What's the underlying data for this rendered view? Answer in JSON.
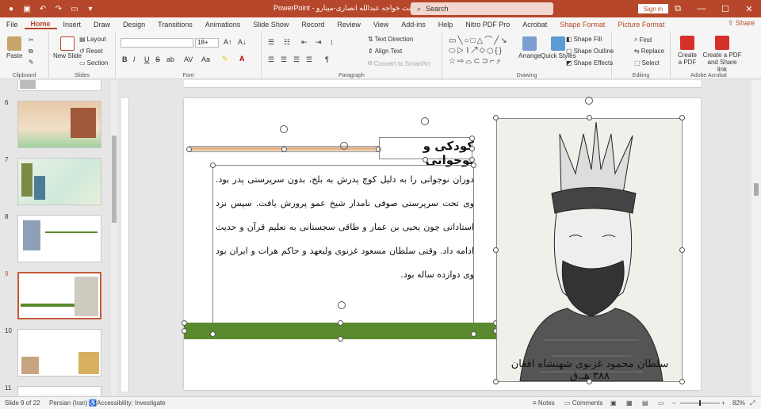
{
  "titlebar": {
    "doc_title": "پاورپوینت خواجه عبدالله انصاری-مینارو  -  PowerPoint",
    "search_placeholder": "Search",
    "signin_label": "Sign in",
    "autosave_label": "Off"
  },
  "menu": {
    "tabs": [
      "File",
      "Home",
      "Insert",
      "Draw",
      "Design",
      "Transitions",
      "Animations",
      "Slide Show",
      "Record",
      "Review",
      "View",
      "Add-ins",
      "Help",
      "Nitro PDF Pro",
      "Acrobat",
      "Shape Format",
      "Picture Format"
    ],
    "active": "Home",
    "share_label": "Share"
  },
  "ribbon": {
    "clipboard": {
      "label": "Clipboard",
      "paste": "Paste"
    },
    "slides": {
      "label": "Slides",
      "new_slide": "New Slide",
      "layout": "Layout",
      "reset": "Reset",
      "section": "Section"
    },
    "font": {
      "label": "Font",
      "font_name": "",
      "font_size": "18+",
      "bold": "B",
      "italic": "I",
      "underline": "U",
      "strike": "S",
      "shadow": "ab",
      "spacing": "AV",
      "case": "Aa"
    },
    "paragraph": {
      "label": "Paragraph",
      "text_direction": "Text Direction",
      "align_text": "Align Text",
      "convert": "Convert to SmartArt"
    },
    "drawing": {
      "label": "Drawing",
      "arrange": "Arrange",
      "quick_styles": "Quick Styles",
      "shape_fill": "Shape Fill",
      "shape_outline": "Shape Outline",
      "shape_effects": "Shape Effects"
    },
    "editing": {
      "label": "Editing",
      "find": "Find",
      "replace": "Replace",
      "select": "Select"
    },
    "adobe": {
      "label": "Adobe Acrobat",
      "create_pdf": "Create a PDF",
      "create_share": "Create a PDF and Share link"
    }
  },
  "thumbnails": [
    {
      "num": "6",
      "selected": false
    },
    {
      "num": "7",
      "selected": false
    },
    {
      "num": "8",
      "selected": false
    },
    {
      "num": "9",
      "selected": true
    },
    {
      "num": "10",
      "selected": false
    },
    {
      "num": "11",
      "selected": false
    }
  ],
  "slide": {
    "heading": "کودکی و نوجوانی",
    "body": "دوران نوجوانی را به دلیل کوچ پدرش به بلخ، بدون سرپرستی پدر بود. وی تحت سرپرستی صوفی نامدار شیخ عمو پرورش یافت. سپس نزد استادانی چون یحیی بن عمار و طاقی سجستانی به تعلیم قرآن و حدیث ادامه داد. وقتی سلطان مسعود غزنوی ولیعهد و حاکم هرات و ایران بود وی دوازده ساله بود.",
    "portrait_caption": "سلطان محمود غزنوی شهنشاه افغان ۳۸۸ هـ.ق"
  },
  "statusbar": {
    "slide_info": "Slide 9 of 22",
    "language": "Persian (Iran)",
    "accessibility": "Accessibility: Investigate",
    "notes": "Notes",
    "comments": "Comments",
    "zoom": "82%"
  },
  "colors": {
    "brand": "#b7472a",
    "green_bar": "#5b8a2e"
  }
}
